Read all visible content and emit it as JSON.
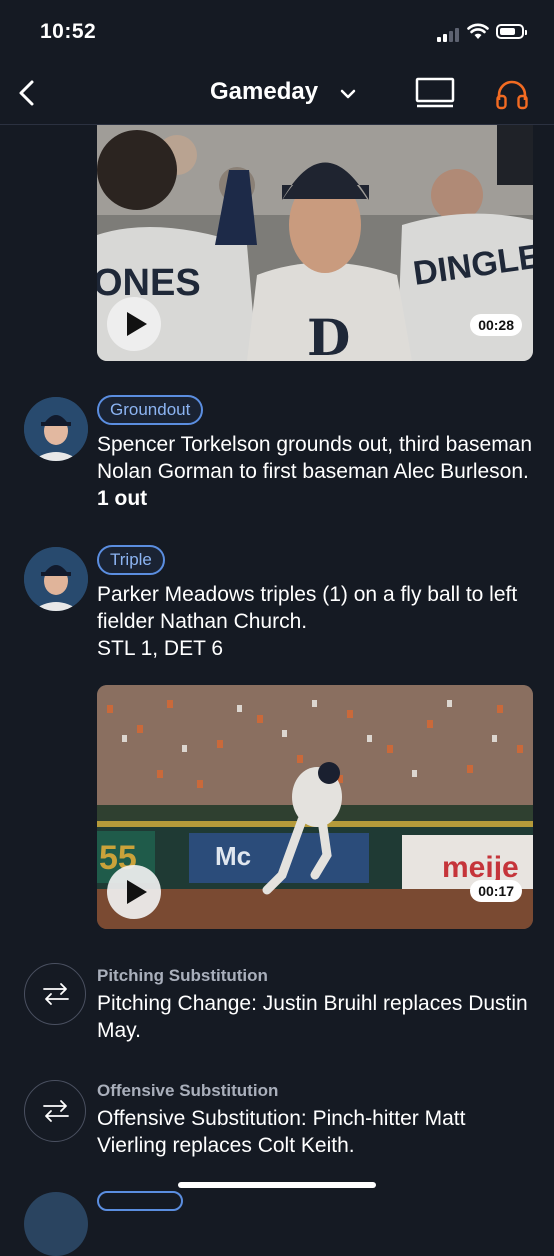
{
  "status_bar": {
    "time": "10:52"
  },
  "nav": {
    "title": "Gameday"
  },
  "videos": [
    {
      "duration": "00:28"
    },
    {
      "duration": "00:17"
    }
  ],
  "feed": [
    {
      "badge": "Groundout",
      "text": "Spencer Torkelson grounds out, third baseman Nolan Gorman to first baseman Alec Burleson.",
      "emphasis": "1 out"
    },
    {
      "badge": "Triple",
      "text": "Parker Meadows triples (1) on a fly ball to left fielder Nathan Church.",
      "score": "STL 1, DET 6"
    }
  ],
  "substitutions": [
    {
      "label": "Pitching Substitution",
      "text": "Pitching Change: Justin Bruihl replaces Dustin May."
    },
    {
      "label": "Offensive Substitution",
      "text": "Offensive Substitution: Pinch-hitter Matt Vierling replaces Colt Keith."
    }
  ],
  "colors": {
    "background": "#151a23",
    "badge_border": "#5b8ee0",
    "accent_orange": "#f26b22"
  }
}
